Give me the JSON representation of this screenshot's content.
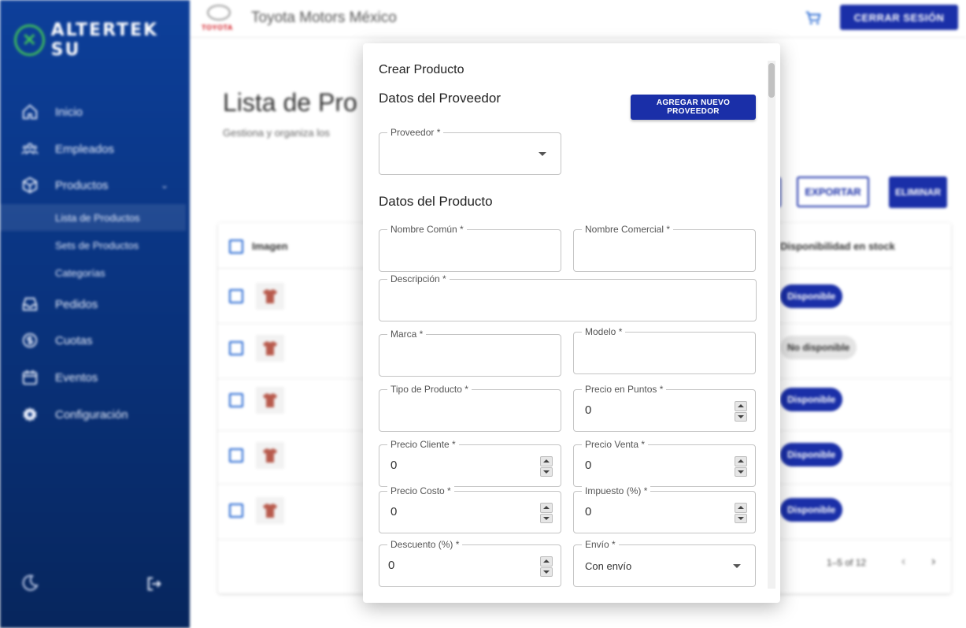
{
  "sidebar": {
    "brand": "ALTERTEK SU",
    "items": [
      {
        "label": "Inicio",
        "icon": "home-icon"
      },
      {
        "label": "Empleados",
        "icon": "people-icon"
      },
      {
        "label": "Productos",
        "icon": "cube-icon"
      },
      {
        "label": "Pedidos",
        "icon": "inbox-icon"
      },
      {
        "label": "Cuotas",
        "icon": "currency-icon"
      },
      {
        "label": "Eventos",
        "icon": "calendar-icon"
      },
      {
        "label": "Configuración",
        "icon": "gear-icon"
      }
    ],
    "sub_items": [
      {
        "label": "Lista de Productos"
      },
      {
        "label": "Sets de Productos"
      },
      {
        "label": "Categorías"
      }
    ]
  },
  "topbar": {
    "logo_word": "TOYOTA",
    "company": "Toyota Motors México",
    "logout_label": "CERRAR SESIÓN"
  },
  "main": {
    "title": "Lista de Pro",
    "subtitle": "Gestiona y organiza los",
    "export_label": "EXPORTAR",
    "delete_label": "ELIMINAR",
    "columns": {
      "image": "Imagen",
      "stock": "Disponibilidad en stock"
    },
    "rows": [
      {
        "stock": "Disponible",
        "available": true
      },
      {
        "stock": "No disponible",
        "available": false
      },
      {
        "stock": "Disponible",
        "available": true
      },
      {
        "stock": "Disponible",
        "available": true
      },
      {
        "stock": "Disponible",
        "available": true
      }
    ],
    "pagination": "1–5 of 12"
  },
  "modal": {
    "title": "Crear Producto",
    "provider_section": "Datos del Proveedor",
    "add_provider_label": "AGREGAR NUEVO PROVEEDOR",
    "provider_label": "Proveedor *",
    "product_section": "Datos del Producto",
    "fields": {
      "common_name": {
        "label": "Nombre Común *",
        "value": ""
      },
      "commercial_name": {
        "label": "Nombre Comercial *",
        "value": ""
      },
      "description": {
        "label": "Descripción *",
        "value": ""
      },
      "brand": {
        "label": "Marca *",
        "value": ""
      },
      "model": {
        "label": "Modelo *",
        "value": ""
      },
      "product_type": {
        "label": "Tipo de Producto *",
        "value": ""
      },
      "points_price": {
        "label": "Precio en Puntos *",
        "value": "0"
      },
      "client_price": {
        "label": "Precio Cliente *",
        "value": "0"
      },
      "sale_price": {
        "label": "Precio Venta *",
        "value": "0"
      },
      "cost_price": {
        "label": "Precio Costo *",
        "value": "0"
      },
      "tax": {
        "label": "Impuesto (%) *",
        "value": "0"
      },
      "discount": {
        "label": "Descuento (%) *",
        "value": "0"
      },
      "shipping": {
        "label": "Envío *",
        "value": "Con envío"
      }
    }
  },
  "colors": {
    "primary": "#1a2fa8",
    "sidebar": "#0a3480",
    "accent_green": "#3fbf5a",
    "toyota_red": "#d0111b"
  }
}
